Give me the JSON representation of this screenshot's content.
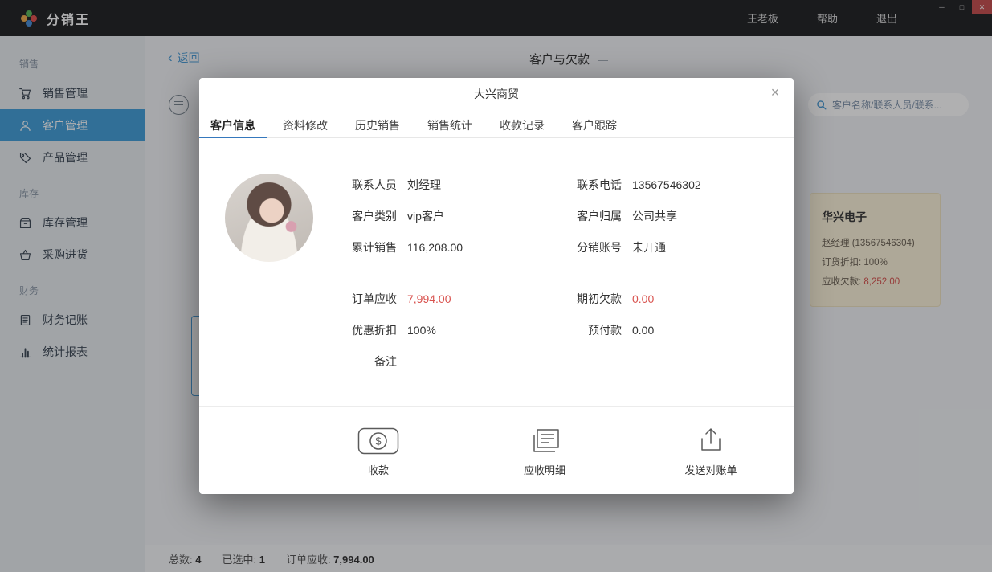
{
  "colors": {
    "accent": "#4a9bd5",
    "accent-dark": "#3578bd",
    "danger": "#d9534f",
    "sidebar-active": "#459fd9"
  },
  "titlebar": {
    "app_name": "分销王",
    "user": "王老板",
    "help_label": "帮助",
    "logout_label": "退出",
    "window_controls": {
      "minimize": "─",
      "maximize": "□",
      "close": "✕"
    }
  },
  "sidebar": {
    "sections": [
      {
        "label": "销售",
        "items": [
          {
            "label": "销售管理"
          },
          {
            "label": "客户管理"
          },
          {
            "label": "产品管理"
          }
        ]
      },
      {
        "label": "库存",
        "items": [
          {
            "label": "库存管理"
          },
          {
            "label": "采购进货"
          }
        ]
      },
      {
        "label": "财务",
        "items": [
          {
            "label": "财务记账"
          },
          {
            "label": "统计报表"
          }
        ]
      }
    ]
  },
  "page": {
    "back_chevron": "‹",
    "back_label": "返回",
    "title": "客户与欠款",
    "title_suffix": "—",
    "search_placeholder": "客户名称/联系人员/联系...",
    "customer_card": {
      "name": "华兴电子",
      "contact": "赵经理 (13567546304)",
      "discount_label": "订货折扣: ",
      "discount_value": "100%",
      "debt_label": "应收欠款: ",
      "debt_value": "8,252.00"
    },
    "statusbar": [
      {
        "label": "总数: ",
        "value": "4"
      },
      {
        "label": "已选中: ",
        "value": "1"
      },
      {
        "label": "订单应收: ",
        "value": "7,994.00"
      }
    ]
  },
  "modal": {
    "title": "大兴商贸",
    "close_glyph": "×",
    "tabs": [
      {
        "label": "客户信息"
      },
      {
        "label": "资料修改"
      },
      {
        "label": "历史销售"
      },
      {
        "label": "销售统计"
      },
      {
        "label": "收款记录"
      },
      {
        "label": "客户跟踪"
      }
    ],
    "active_tab": "客户信息",
    "info": {
      "left": [
        {
          "label": "联系人员",
          "value": "刘经理"
        },
        {
          "label": "客户类别",
          "value": "vip客户"
        },
        {
          "label": "累计销售",
          "value": "116,208.00"
        },
        {
          "label": "订单应收",
          "value": "7,994.00"
        },
        {
          "label": "优惠折扣",
          "value": "100%"
        },
        {
          "label": "备注",
          "value": ""
        }
      ],
      "right": [
        {
          "label": "联系电话",
          "value": "13567546302"
        },
        {
          "label": "客户归属",
          "value": "公司共享"
        },
        {
          "label": "分销账号",
          "value": "未开通"
        },
        {
          "label": "期初欠款",
          "value": "0.00"
        },
        {
          "label": "预付款",
          "value": "0.00"
        }
      ]
    },
    "actions": [
      {
        "label": "收款",
        "icon": "dollar-badge-icon",
        "glyph": "$"
      },
      {
        "label": "应收明细",
        "icon": "receivable-detail-icon"
      },
      {
        "label": "发送对账单",
        "icon": "send-statement-icon"
      }
    ]
  }
}
